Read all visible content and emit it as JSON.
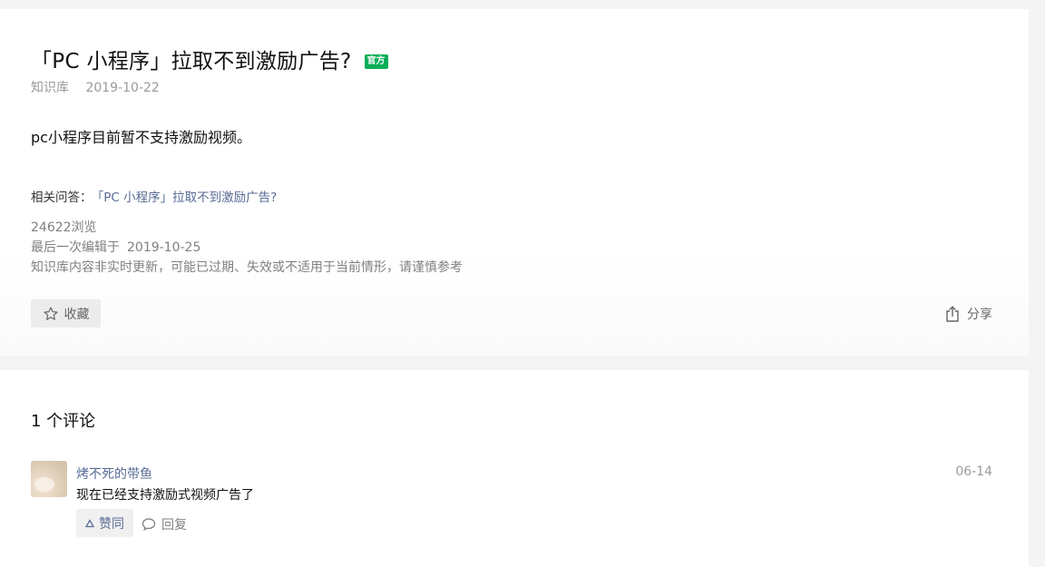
{
  "article": {
    "title": "「PC 小程序」拉取不到激励广告?",
    "official_badge": "官方",
    "category": "知识库",
    "date": "2019-10-22",
    "body": "pc小程序目前暂不支持激励视频。",
    "related_label": "相关问答：",
    "related_link": "「PC 小程序」拉取不到激励广告?",
    "views": "24622浏览",
    "last_edit_label": "最后一次编辑于",
    "last_edit_date": "2019-10-25",
    "disclaimer": "知识库内容非实时更新，可能已过期、失效或不适用于当前情形，请谨慎参考",
    "collect_label": "收藏",
    "share_label": "分享"
  },
  "comments": {
    "title": "1 个评论",
    "items": [
      {
        "author": "烤不死的带鱼",
        "date": "06-14",
        "text": "现在已经支持激励式视频广告了",
        "like_label": "赞同",
        "reply_label": "回复"
      }
    ]
  },
  "colors": {
    "link": "#576b95",
    "official_badge": "#06ae56",
    "muted": "#9a9a9a"
  },
  "icons": {
    "collect": "star-icon",
    "share": "share-icon",
    "like": "triangle-up-icon",
    "reply": "comment-bubble-icon"
  }
}
